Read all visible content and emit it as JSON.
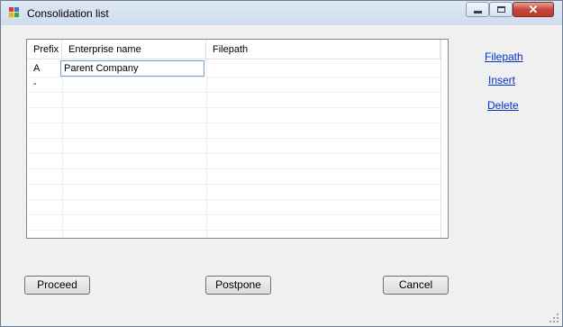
{
  "window": {
    "title": "Consolidation list",
    "close_glyph": "✕"
  },
  "grid": {
    "columns": [
      "Prefix",
      "Enterprise name",
      "Filepath"
    ],
    "rows": [
      {
        "prefix": "A",
        "enterprise_name": "Parent Company",
        "filepath": ""
      },
      {
        "prefix": "-",
        "enterprise_name": "",
        "filepath": ""
      }
    ]
  },
  "links": {
    "filepath": "Filepath",
    "insert": "Insert",
    "delete": "Delete"
  },
  "buttons": {
    "proceed": "Proceed",
    "postpone": "Postpone",
    "cancel": "Cancel"
  },
  "colors": {
    "link": "#0033cc",
    "edit_border": "#7a9cd3"
  }
}
